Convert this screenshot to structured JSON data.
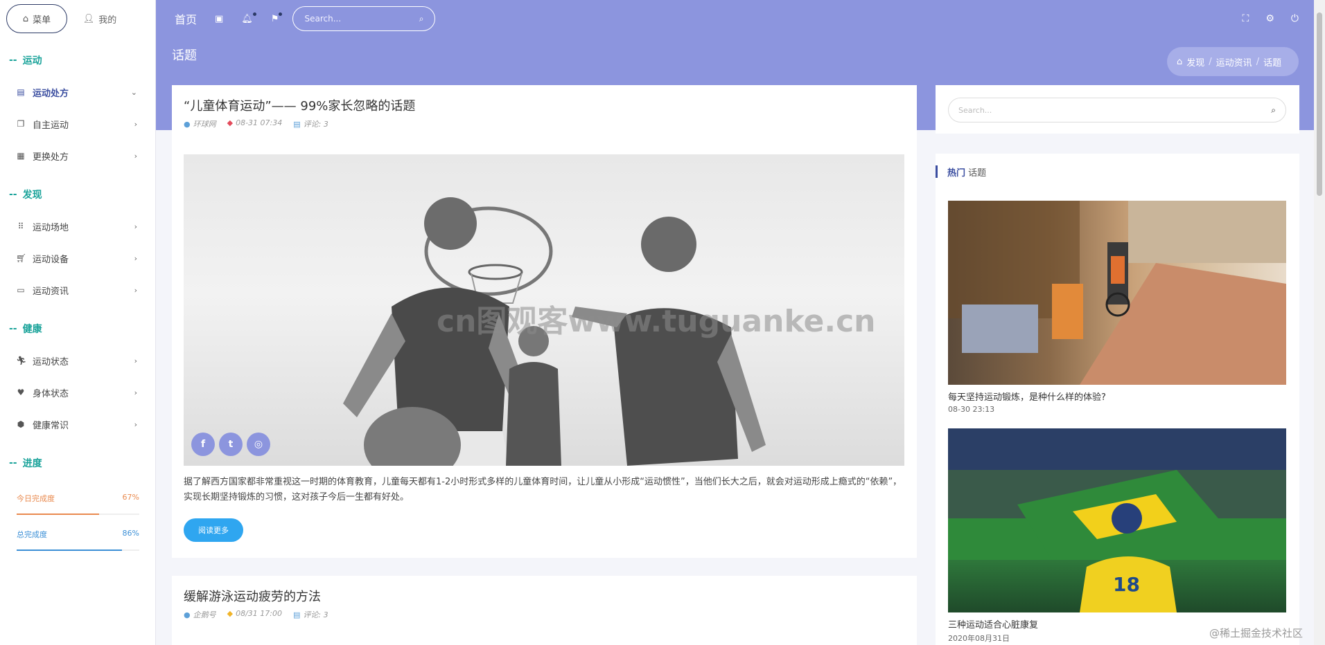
{
  "sidebar": {
    "tabs": [
      {
        "label": "菜单",
        "icon": "home-icon"
      },
      {
        "label": "我的",
        "icon": "user-icon"
      }
    ],
    "sections": [
      {
        "title": "运动",
        "items": [
          {
            "label": "运动处方",
            "icon": "clipboard-icon",
            "arrow": "chevron-down-icon",
            "active": true
          },
          {
            "label": "自主运动",
            "icon": "copy-icon",
            "arrow": "chevron-right-icon"
          },
          {
            "label": "更换处方",
            "icon": "calendar-icon",
            "arrow": "chevron-right-icon"
          }
        ]
      },
      {
        "title": "发现",
        "items": [
          {
            "label": "运动场地",
            "icon": "grid-icon",
            "arrow": "chevron-right-icon"
          },
          {
            "label": "运动设备",
            "icon": "cart-icon",
            "arrow": "chevron-right-icon"
          },
          {
            "label": "运动资讯",
            "icon": "monitor-icon",
            "arrow": "chevron-right-icon"
          }
        ]
      },
      {
        "title": "健康",
        "items": [
          {
            "label": "运动状态",
            "icon": "runner-icon",
            "arrow": "chevron-right-icon"
          },
          {
            "label": "身体状态",
            "icon": "heart-icon",
            "arrow": "chevron-right-icon"
          },
          {
            "label": "健康常识",
            "icon": "box-icon",
            "arrow": "chevron-right-icon"
          }
        ]
      }
    ],
    "progress_title": "进度",
    "progress": [
      {
        "label": "今日完成度",
        "value": "67%",
        "fraction": 0.67,
        "color": "#e98a4f"
      },
      {
        "label": "总完成度",
        "value": "86%",
        "fraction": 0.86,
        "color": "#3b8fd6"
      }
    ]
  },
  "header": {
    "home": "首页",
    "icons": [
      "layout-icon",
      "bell-icon",
      "flag-icon"
    ],
    "search_placeholder": "Search...",
    "right_icons": [
      "fullscreen-icon",
      "gear-icon",
      "power-icon"
    ],
    "bg_color": "#8c95de"
  },
  "page": {
    "title": "话题",
    "breadcrumb": [
      "发现",
      "运动资讯",
      "话题"
    ]
  },
  "posts": [
    {
      "title": "“儿童体育运动”—— 99%家长忽略的话题",
      "author": "环球网",
      "date": "08-31 07:34",
      "comments": "评论: 3",
      "watermark": "cn图观客www.tuguanke.cn",
      "social": [
        "f",
        "t",
        "◎"
      ],
      "body": "据了解西方国家都非常重视这一时期的体育教育，儿童每天都有1-2小时形式多样的儿童体育时间，让儿童从小形成“运动惯性”，当他们长大之后，就会对运动形成上瘾式的“依赖”，实现长期坚持锻炼的习惯，这对孩子今后一生都有好处。",
      "read_more": "阅读更多"
    },
    {
      "title": "缓解游泳运动疲劳的方法",
      "author": "企鹅号",
      "date": "08/31 17:00",
      "comments": "评论: 3"
    }
  ],
  "right": {
    "search_placeholder": "Search...",
    "hot_head_a": "热门",
    "hot_head_b": "话题",
    "items": [
      {
        "caption": "每天坚持运动锻炼，是种什么样的体验?",
        "date": "08-30 23:13"
      },
      {
        "caption": "三种运动适合心脏康复",
        "date": "2020年08月31日"
      }
    ]
  },
  "corner_watermark": "@稀土掘金技术社区"
}
